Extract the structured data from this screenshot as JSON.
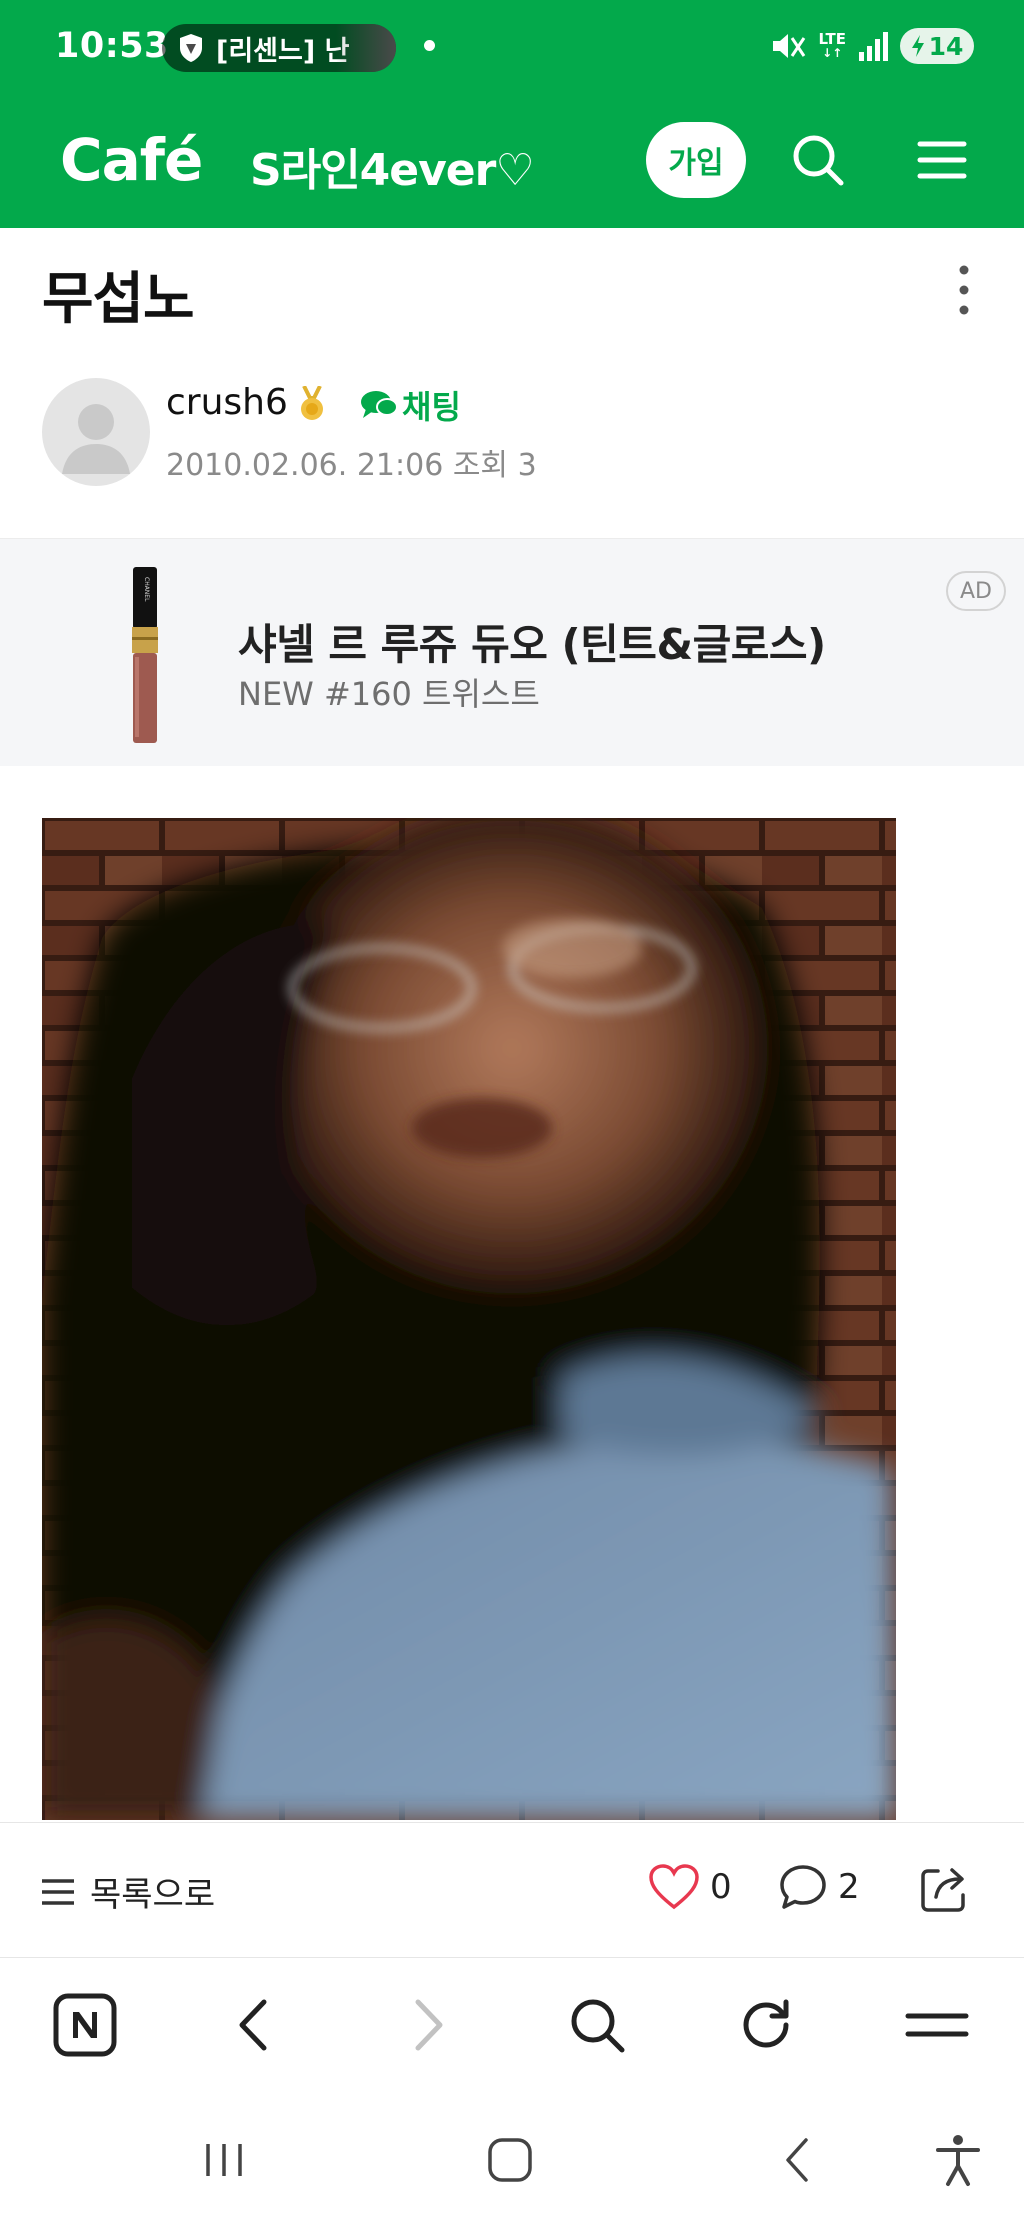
{
  "status_bar": {
    "time": "10:53",
    "notification": "[리센느] 난",
    "network": "LTE",
    "battery": "14"
  },
  "app_bar": {
    "brand": "Café",
    "cafe_name": "S라인4ever♡",
    "join_label": "가입"
  },
  "post": {
    "title": "무섭노",
    "author": "crush6",
    "chat_label": "채팅",
    "meta": "2010.02.06. 21:06 조회 3"
  },
  "ad": {
    "title": "샤넬 르 루쥬 듀오 (틴트&글로스)",
    "subtitle": "NEW #160 트위스트",
    "badge": "AD"
  },
  "actions": {
    "list_label": "목록으로",
    "likes": "0",
    "comments": "2"
  },
  "colors": {
    "brand_green": "#03a94b",
    "like_red": "#e8384f"
  },
  "icons": [
    "shield-icon",
    "mute-icon",
    "signal-icon",
    "search-icon",
    "menu-icon",
    "more-icon",
    "medal-icon",
    "chat-icon",
    "list-icon",
    "heart-icon",
    "comment-icon",
    "share-icon",
    "naver-home-icon",
    "back-icon",
    "forward-icon",
    "refresh-icon",
    "recent-apps-icon",
    "home-icon",
    "accessibility-icon"
  ]
}
